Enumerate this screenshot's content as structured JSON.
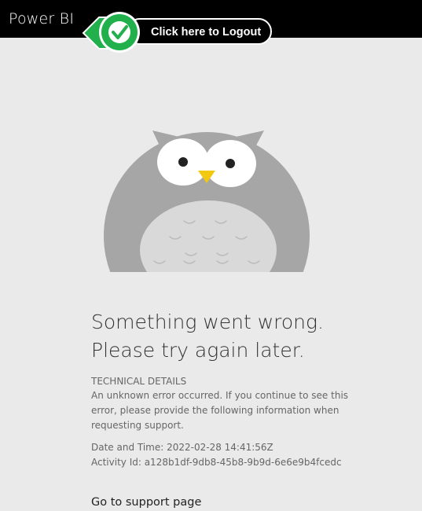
{
  "header": {
    "app_title": "Power BI"
  },
  "logout_callout": {
    "label": "Click here to Logout",
    "icon": "checkmark-icon",
    "accent_color": "#1fb14a"
  },
  "error": {
    "title_line1": "Something went wrong.",
    "title_line2": "Please try again later.",
    "technical_heading": "TECHNICAL DETAILS",
    "description": "An unknown error occurred. If you continue to see this error, please provide the following information when requesting support.",
    "datetime": "Date and Time: 2022-02-28 14:41:56Z",
    "activity_id": "Activity Id: a128b1df-9db8-45b8-9b9d-6e6e9b4fcedc"
  },
  "links": {
    "support": "Go to support page"
  },
  "colors": {
    "topbar": "#000000",
    "background": "#eaeaea",
    "owl_body": "#a6a6a6",
    "owl_belly": "#d9d9d9",
    "owl_beak": "#f2c811"
  }
}
